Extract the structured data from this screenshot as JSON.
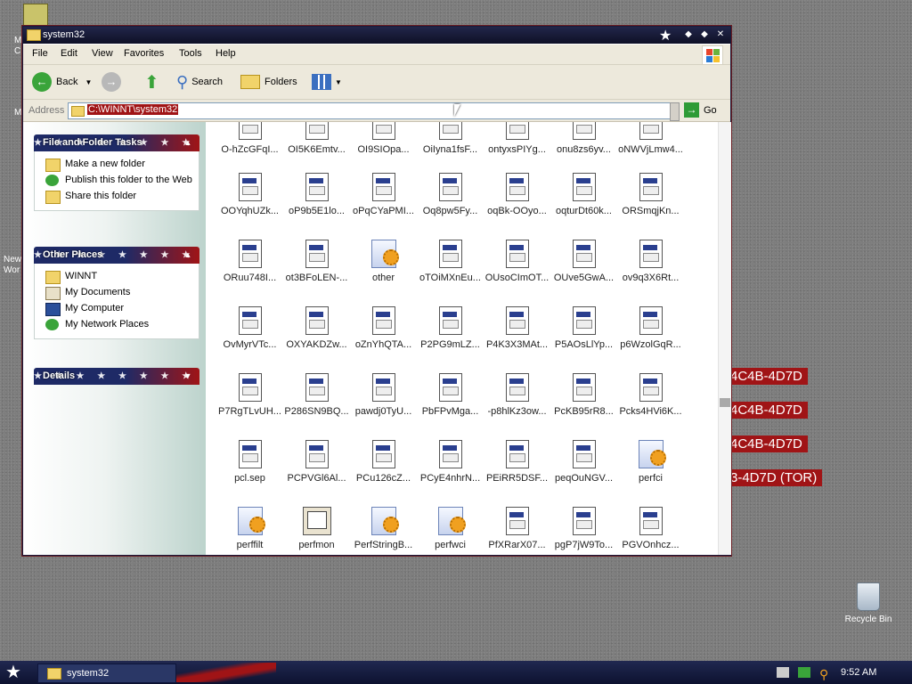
{
  "window": {
    "title": "system32"
  },
  "menu": [
    "File",
    "Edit",
    "View",
    "Favorites",
    "Tools",
    "Help"
  ],
  "toolbar": {
    "back": "Back",
    "search": "Search",
    "folders": "Folders"
  },
  "address": {
    "label": "Address",
    "value": "C:\\WINNT\\system32",
    "go": "Go"
  },
  "left_panels": {
    "tasks": {
      "title": "File and Folder Tasks",
      "items": [
        "Make a new folder",
        "Publish this folder to the Web",
        "Share this folder"
      ]
    },
    "places": {
      "title": "Other Places",
      "items": [
        "WINNT",
        "My Documents",
        "My Computer",
        "My Network Places"
      ]
    },
    "details": {
      "title": "Details"
    }
  },
  "files": [
    [
      "O-hZcGFqI...",
      "OI5K6Emtv...",
      "OI9SIOpa...",
      "OiIyna1fsF...",
      "ontyxsPIYg...",
      "onu8zs6yv...",
      "oNWVjLmw4..."
    ],
    [
      "OOYqhUZk...",
      "oP9b5E1lo...",
      "oPqCYaPMI...",
      "Oq8pw5Fy...",
      "oqBk-OOyo...",
      "oqturDt60k...",
      "ORSmqjKn..."
    ],
    [
      "ORuu748I...",
      "ot3BFoLEN-...",
      "other",
      "oTOiMXnEu...",
      "OUsoCImOT...",
      "OUve5GwA...",
      "ov9q3X6Rt..."
    ],
    [
      "OvMyrVTc...",
      "OXYAKDZw...",
      "oZnYhQTA...",
      "P2PG9mLZ...",
      "P4K3X3MAt...",
      "P5AOsLlYp...",
      "p6WzolGqR..."
    ],
    [
      "P7RgTLvUH...",
      "P286SN9BQ...",
      "pawdj0TyU...",
      "PbFPvMga...",
      "-p8hlKz3ow...",
      "PcKB95rR8...",
      "Pcks4HVi6K..."
    ],
    [
      "pcl.sep",
      "PCPVGl6Al...",
      "PCu126cZ...",
      "PCyE4nhrN...",
      "PEiRR5DSF...",
      "peqOuNGV...",
      "perfci"
    ],
    [
      "perffilt",
      "perfmon",
      "PerfStringB...",
      "perfwci",
      "PfXRarX07...",
      "pgP7jW9To...",
      "PGVOnhcz..."
    ]
  ],
  "file_types": [
    [
      "doc",
      "doc",
      "doc",
      "doc",
      "doc",
      "doc",
      "doc"
    ],
    [
      "doc",
      "doc",
      "doc",
      "doc",
      "doc",
      "doc",
      "doc"
    ],
    [
      "doc",
      "doc",
      "gear",
      "doc",
      "doc",
      "doc",
      "doc"
    ],
    [
      "doc",
      "doc",
      "doc",
      "doc",
      "doc",
      "doc",
      "doc"
    ],
    [
      "doc",
      "doc",
      "doc",
      "doc",
      "doc",
      "doc",
      "doc"
    ],
    [
      "doc",
      "doc",
      "doc",
      "doc",
      "doc",
      "doc",
      "gear"
    ],
    [
      "gear",
      "monitor",
      "gear",
      "gear",
      "doc",
      "doc",
      "doc"
    ]
  ],
  "desktop": {
    "banners": [
      "4C4B-4D7D",
      "4C4B-4D7D",
      "4C4B-4D7D",
      "3-4D7D (TOR)"
    ],
    "recycle_bin": "Recycle Bin",
    "fragments": [
      "M",
      "C",
      "M",
      "New",
      "Wor"
    ]
  },
  "taskbar": {
    "task": "system32",
    "clock": "9:52 AM"
  },
  "colors": {
    "accent_red": "#a01416",
    "navy": "#1e2a66"
  }
}
